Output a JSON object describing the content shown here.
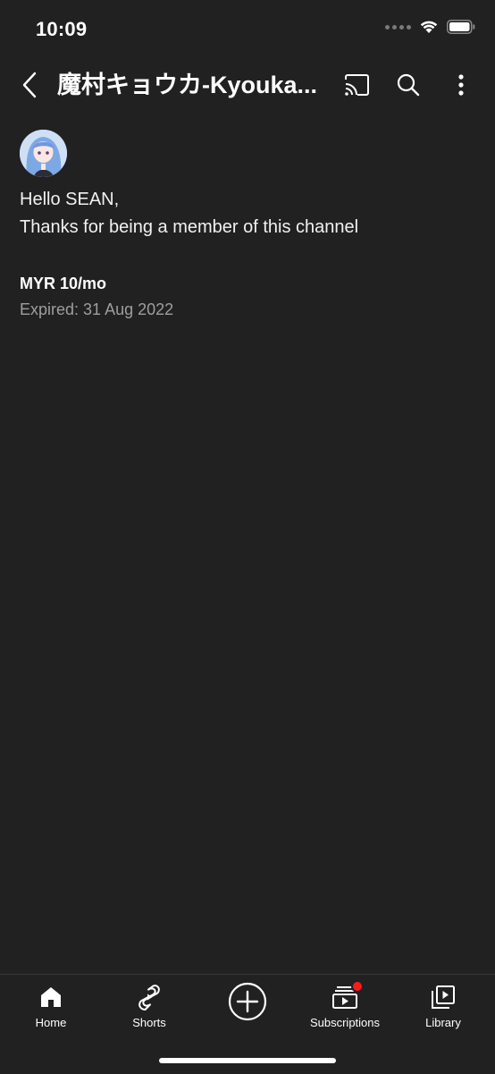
{
  "status_bar": {
    "time": "10:09"
  },
  "header": {
    "title": "魔村キョウカ-Kyouka..."
  },
  "icons": {
    "back": "chevron-left-icon",
    "cast": "cast-icon",
    "search": "search-icon",
    "more": "more-vertical-icon"
  },
  "membership": {
    "greeting_line1": "Hello SEAN,",
    "greeting_line2": "Thanks for being a member of this channel",
    "price": "MYR 10/mo",
    "expiry": "Expired: 31 Aug 2022"
  },
  "nav": {
    "items": [
      {
        "label": "Home",
        "icon": "home-icon"
      },
      {
        "label": "Shorts",
        "icon": "shorts-icon"
      },
      {
        "label": "",
        "icon": "create-plus-icon"
      },
      {
        "label": "Subscriptions",
        "icon": "subscriptions-icon"
      },
      {
        "label": "Library",
        "icon": "library-icon"
      }
    ]
  },
  "colors": {
    "background": "#212121",
    "text_primary": "#ffffff",
    "text_secondary": "#9e9e9e",
    "badge": "#ff1a1a"
  }
}
